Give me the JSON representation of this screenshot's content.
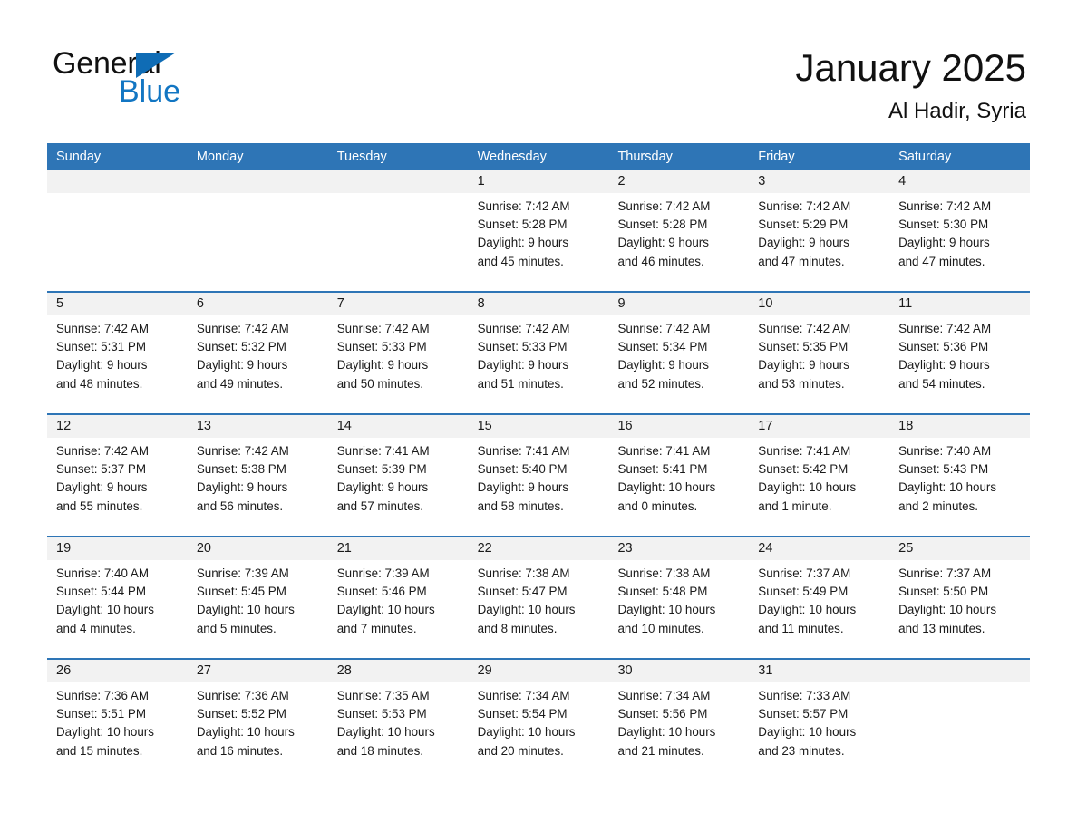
{
  "brand": {
    "name_part1": "General",
    "name_part2": "Blue",
    "accent_color": "#1276c3",
    "triangle_color": "#0f6cb5"
  },
  "header": {
    "title": "January 2025",
    "subtitle": "Al Hadir, Syria"
  },
  "theme": {
    "header_blue": "#2e75b6",
    "daynum_band": "#f2f2f2",
    "text": "#1a1a1a"
  },
  "weekdays": [
    "Sunday",
    "Monday",
    "Tuesday",
    "Wednesday",
    "Thursday",
    "Friday",
    "Saturday"
  ],
  "weeks": [
    {
      "days": [
        {
          "num": "",
          "lines": [
            "",
            "",
            "",
            ""
          ]
        },
        {
          "num": "",
          "lines": [
            "",
            "",
            "",
            ""
          ]
        },
        {
          "num": "",
          "lines": [
            "",
            "",
            "",
            ""
          ]
        },
        {
          "num": "1",
          "lines": [
            "Sunrise: 7:42 AM",
            "Sunset: 5:28 PM",
            "Daylight: 9 hours",
            "and 45 minutes."
          ]
        },
        {
          "num": "2",
          "lines": [
            "Sunrise: 7:42 AM",
            "Sunset: 5:28 PM",
            "Daylight: 9 hours",
            "and 46 minutes."
          ]
        },
        {
          "num": "3",
          "lines": [
            "Sunrise: 7:42 AM",
            "Sunset: 5:29 PM",
            "Daylight: 9 hours",
            "and 47 minutes."
          ]
        },
        {
          "num": "4",
          "lines": [
            "Sunrise: 7:42 AM",
            "Sunset: 5:30 PM",
            "Daylight: 9 hours",
            "and 47 minutes."
          ]
        }
      ]
    },
    {
      "days": [
        {
          "num": "5",
          "lines": [
            "Sunrise: 7:42 AM",
            "Sunset: 5:31 PM",
            "Daylight: 9 hours",
            "and 48 minutes."
          ]
        },
        {
          "num": "6",
          "lines": [
            "Sunrise: 7:42 AM",
            "Sunset: 5:32 PM",
            "Daylight: 9 hours",
            "and 49 minutes."
          ]
        },
        {
          "num": "7",
          "lines": [
            "Sunrise: 7:42 AM",
            "Sunset: 5:33 PM",
            "Daylight: 9 hours",
            "and 50 minutes."
          ]
        },
        {
          "num": "8",
          "lines": [
            "Sunrise: 7:42 AM",
            "Sunset: 5:33 PM",
            "Daylight: 9 hours",
            "and 51 minutes."
          ]
        },
        {
          "num": "9",
          "lines": [
            "Sunrise: 7:42 AM",
            "Sunset: 5:34 PM",
            "Daylight: 9 hours",
            "and 52 minutes."
          ]
        },
        {
          "num": "10",
          "lines": [
            "Sunrise: 7:42 AM",
            "Sunset: 5:35 PM",
            "Daylight: 9 hours",
            "and 53 minutes."
          ]
        },
        {
          "num": "11",
          "lines": [
            "Sunrise: 7:42 AM",
            "Sunset: 5:36 PM",
            "Daylight: 9 hours",
            "and 54 minutes."
          ]
        }
      ]
    },
    {
      "days": [
        {
          "num": "12",
          "lines": [
            "Sunrise: 7:42 AM",
            "Sunset: 5:37 PM",
            "Daylight: 9 hours",
            "and 55 minutes."
          ]
        },
        {
          "num": "13",
          "lines": [
            "Sunrise: 7:42 AM",
            "Sunset: 5:38 PM",
            "Daylight: 9 hours",
            "and 56 minutes."
          ]
        },
        {
          "num": "14",
          "lines": [
            "Sunrise: 7:41 AM",
            "Sunset: 5:39 PM",
            "Daylight: 9 hours",
            "and 57 minutes."
          ]
        },
        {
          "num": "15",
          "lines": [
            "Sunrise: 7:41 AM",
            "Sunset: 5:40 PM",
            "Daylight: 9 hours",
            "and 58 minutes."
          ]
        },
        {
          "num": "16",
          "lines": [
            "Sunrise: 7:41 AM",
            "Sunset: 5:41 PM",
            "Daylight: 10 hours",
            "and 0 minutes."
          ]
        },
        {
          "num": "17",
          "lines": [
            "Sunrise: 7:41 AM",
            "Sunset: 5:42 PM",
            "Daylight: 10 hours",
            "and 1 minute."
          ]
        },
        {
          "num": "18",
          "lines": [
            "Sunrise: 7:40 AM",
            "Sunset: 5:43 PM",
            "Daylight: 10 hours",
            "and 2 minutes."
          ]
        }
      ]
    },
    {
      "days": [
        {
          "num": "19",
          "lines": [
            "Sunrise: 7:40 AM",
            "Sunset: 5:44 PM",
            "Daylight: 10 hours",
            "and 4 minutes."
          ]
        },
        {
          "num": "20",
          "lines": [
            "Sunrise: 7:39 AM",
            "Sunset: 5:45 PM",
            "Daylight: 10 hours",
            "and 5 minutes."
          ]
        },
        {
          "num": "21",
          "lines": [
            "Sunrise: 7:39 AM",
            "Sunset: 5:46 PM",
            "Daylight: 10 hours",
            "and 7 minutes."
          ]
        },
        {
          "num": "22",
          "lines": [
            "Sunrise: 7:38 AM",
            "Sunset: 5:47 PM",
            "Daylight: 10 hours",
            "and 8 minutes."
          ]
        },
        {
          "num": "23",
          "lines": [
            "Sunrise: 7:38 AM",
            "Sunset: 5:48 PM",
            "Daylight: 10 hours",
            "and 10 minutes."
          ]
        },
        {
          "num": "24",
          "lines": [
            "Sunrise: 7:37 AM",
            "Sunset: 5:49 PM",
            "Daylight: 10 hours",
            "and 11 minutes."
          ]
        },
        {
          "num": "25",
          "lines": [
            "Sunrise: 7:37 AM",
            "Sunset: 5:50 PM",
            "Daylight: 10 hours",
            "and 13 minutes."
          ]
        }
      ]
    },
    {
      "days": [
        {
          "num": "26",
          "lines": [
            "Sunrise: 7:36 AM",
            "Sunset: 5:51 PM",
            "Daylight: 10 hours",
            "and 15 minutes."
          ]
        },
        {
          "num": "27",
          "lines": [
            "Sunrise: 7:36 AM",
            "Sunset: 5:52 PM",
            "Daylight: 10 hours",
            "and 16 minutes."
          ]
        },
        {
          "num": "28",
          "lines": [
            "Sunrise: 7:35 AM",
            "Sunset: 5:53 PM",
            "Daylight: 10 hours",
            "and 18 minutes."
          ]
        },
        {
          "num": "29",
          "lines": [
            "Sunrise: 7:34 AM",
            "Sunset: 5:54 PM",
            "Daylight: 10 hours",
            "and 20 minutes."
          ]
        },
        {
          "num": "30",
          "lines": [
            "Sunrise: 7:34 AM",
            "Sunset: 5:56 PM",
            "Daylight: 10 hours",
            "and 21 minutes."
          ]
        },
        {
          "num": "31",
          "lines": [
            "Sunrise: 7:33 AM",
            "Sunset: 5:57 PM",
            "Daylight: 10 hours",
            "and 23 minutes."
          ]
        },
        {
          "num": "",
          "lines": [
            "",
            "",
            "",
            ""
          ]
        }
      ]
    }
  ]
}
